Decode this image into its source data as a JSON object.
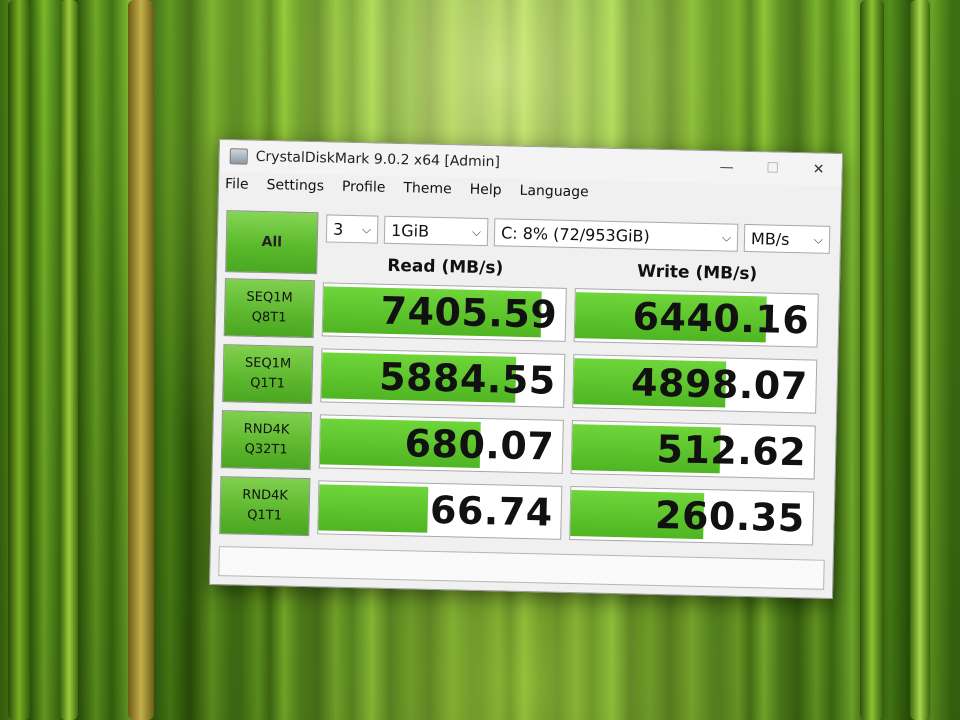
{
  "window": {
    "title": "CrystalDiskMark 9.0.2 x64 [Admin]",
    "controls": {
      "minimize": "—",
      "maximize": "☐",
      "close": "✕"
    }
  },
  "menu": [
    "File",
    "Settings",
    "Profile",
    "Theme",
    "Help",
    "Language"
  ],
  "toolbar": {
    "all_label": "All",
    "count": "3",
    "size": "1GiB",
    "drive": "C: 8% (72/953GiB)",
    "unit": "MB/s"
  },
  "headers": {
    "read": "Read (MB/s)",
    "write": "Write (MB/s)"
  },
  "tests": [
    {
      "line1": "SEQ1M",
      "line2": "Q8T1",
      "read": "7405.59",
      "write": "6440.16",
      "read_fill": 0.9,
      "write_fill": 0.79
    },
    {
      "line1": "SEQ1M",
      "line2": "Q1T1",
      "read": "5884.55",
      "write": "4898.07",
      "read_fill": 0.8,
      "write_fill": 0.63
    },
    {
      "line1": "RND4K",
      "line2": "Q32T1",
      "read": "680.07",
      "write": "512.62",
      "read_fill": 0.66,
      "write_fill": 0.61
    },
    {
      "line1": "RND4K",
      "line2": "Q1T1",
      "read": "66.74",
      "write": "260.35",
      "read_fill": 0.45,
      "write_fill": 0.55
    }
  ],
  "status": "",
  "colors": {
    "bar_green": "#5cba2c",
    "window_bg": "#f0f0f0"
  }
}
